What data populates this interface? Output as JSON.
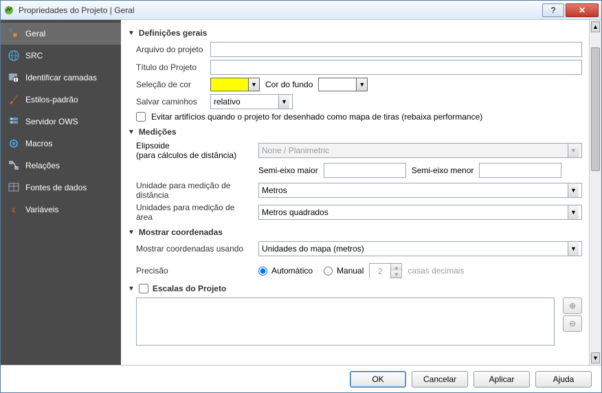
{
  "window": {
    "title": "Propriedades do Projeto | Geral"
  },
  "sidebar": {
    "items": [
      {
        "label": "Geral"
      },
      {
        "label": "SRC"
      },
      {
        "label": "Identificar camadas"
      },
      {
        "label": "Estilos-padrão"
      },
      {
        "label": "Servidor OWS"
      },
      {
        "label": "Macros"
      },
      {
        "label": "Relações"
      },
      {
        "label": "Fontes de dados"
      },
      {
        "label": "Variáveis"
      }
    ]
  },
  "sections": {
    "general": {
      "title": "Definições gerais",
      "project_file_label": "Arquivo do projeto",
      "project_file": "",
      "project_title_label": "Título do Projeto",
      "project_title": "",
      "selection_color_label": "Seleção de cor",
      "selection_color": "#ffff00",
      "bg_color_label": "Cor do fundo",
      "bg_color": "#ffffff",
      "save_paths_label": "Salvar caminhos",
      "save_paths_value": "relativo",
      "avoid_artifacts_label": "Evitar artifícios quando o projeto for desenhado como mapa de tiras (rebaixa performance)"
    },
    "measure": {
      "title": "Medições",
      "ellipsoid_label": "Elipsoide",
      "ellipsoid_sub": "(para cálculos de distância)",
      "ellipsoid_value": "None / Planimetric",
      "semi_major_label": "Semi-eixo maior",
      "semi_major": "",
      "semi_minor_label": "Semi-eixo menor",
      "semi_minor": "",
      "dist_unit_label": "Unidade para medição de distância",
      "dist_unit_value": "Metros",
      "area_unit_label": "Unidades para medição de área",
      "area_unit_value": "Metros quadrados"
    },
    "coords": {
      "title": "Mostrar coordenadas",
      "show_using_label": "Mostrar coordenadas usando",
      "show_using_value": "Unidades do mapa (metros)",
      "precision_label": "Precisão",
      "auto_label": "Automático",
      "manual_label": "Manual",
      "precision_value": "2",
      "decimal_places_label": "casas decimais"
    },
    "scales": {
      "title": "Escalas do Projeto"
    }
  },
  "footer": {
    "ok": "OK",
    "cancel": "Cancelar",
    "apply": "Aplicar",
    "help": "Ajuda"
  }
}
